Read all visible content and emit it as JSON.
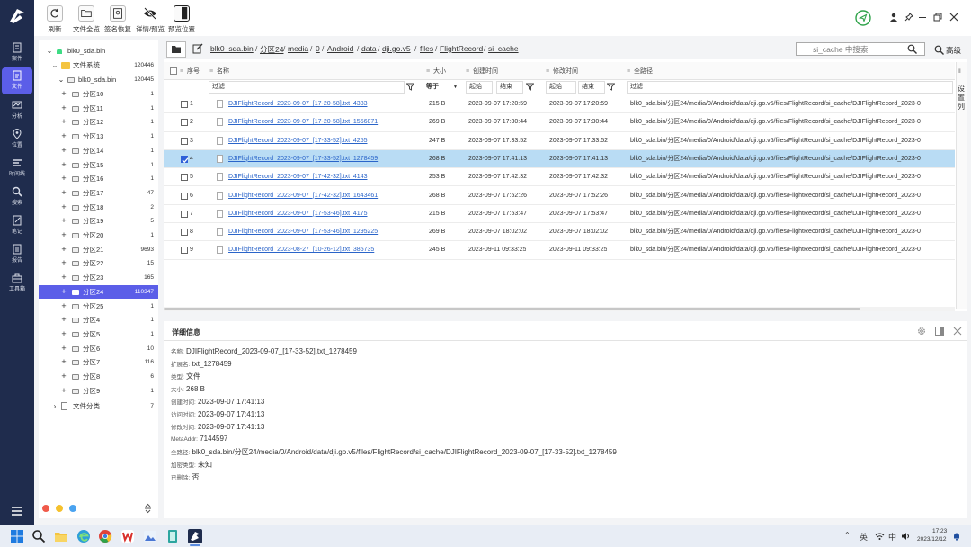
{
  "toolbar": {
    "refresh": "刷新",
    "file_overview": "文件全览",
    "signature_recovery": "签名恢复",
    "detail_preview": "详情/预览",
    "preview_position": "预览位置"
  },
  "rail": {
    "items": [
      "案件",
      "文件",
      "分析",
      "位置",
      "时间线",
      "搜索",
      "笔记",
      "报告",
      "工具箱"
    ]
  },
  "tree": {
    "root": "blk0_sda.bin",
    "fs": "文件系统",
    "fs_count": "120446",
    "disk": "blk0_sda.bin",
    "disk_count": "120445",
    "partitions": [
      {
        "name": "分区10",
        "count": "1"
      },
      {
        "name": "分区11",
        "count": "1"
      },
      {
        "name": "分区12",
        "count": "1"
      },
      {
        "name": "分区13",
        "count": "1"
      },
      {
        "name": "分区14",
        "count": "1"
      },
      {
        "name": "分区15",
        "count": "1"
      },
      {
        "name": "分区16",
        "count": "1"
      },
      {
        "name": "分区17",
        "count": "47"
      },
      {
        "name": "分区18",
        "count": "2"
      },
      {
        "name": "分区19",
        "count": "5"
      },
      {
        "name": "分区20",
        "count": "1"
      },
      {
        "name": "分区21",
        "count": "9693"
      },
      {
        "name": "分区22",
        "count": "15"
      },
      {
        "name": "分区23",
        "count": "165"
      },
      {
        "name": "分区24",
        "count": "110347"
      },
      {
        "name": "分区25",
        "count": "1"
      },
      {
        "name": "分区4",
        "count": "1"
      },
      {
        "name": "分区5",
        "count": "1"
      },
      {
        "name": "分区6",
        "count": "10"
      },
      {
        "name": "分区7",
        "count": "116"
      },
      {
        "name": "分区8",
        "count": "6"
      },
      {
        "name": "分区9",
        "count": "1"
      }
    ],
    "file_class": "文件分类",
    "file_class_count": "7"
  },
  "path": {
    "crumbs": [
      "blk0_sda.bin",
      "分区24",
      "media",
      "0",
      "Android",
      "data",
      "dji.go.v5",
      "files",
      "FlightRecord",
      "si_cache"
    ],
    "search_placeholder": "si_cache 中搜索",
    "advanced": "高级"
  },
  "table": {
    "headers": {
      "seq": "序号",
      "name": "名称",
      "size": "大小",
      "created": "创建时间",
      "modified": "修改时间",
      "fullpath": "全路径"
    },
    "filter": "过滤",
    "size_op": "等于",
    "start": "起始",
    "end": "结束",
    "settings_col": "设置列",
    "rows": [
      {
        "seq": "1",
        "name": "DJIFlightRecord_2023-09-07_[17-20-58].txt_4383",
        "size": "215 B",
        "created": "2023-09-07 17:20:59",
        "modified": "2023-09-07 17:20:59",
        "path": "blk0_sda.bin/分区24/media/0/Android/data/dji.go.v5/files/FlightRecord/si_cache/DJIFlightRecord_2023-0"
      },
      {
        "seq": "2",
        "name": "DJIFlightRecord_2023-09-07_[17-20-58].txt_1556871",
        "size": "269 B",
        "created": "2023-09-07 17:30:44",
        "modified": "2023-09-07 17:30:44",
        "path": "blk0_sda.bin/分区24/media/0/Android/data/dji.go.v5/files/FlightRecord/si_cache/DJIFlightRecord_2023-0"
      },
      {
        "seq": "3",
        "name": "DJIFlightRecord_2023-09-07_[17-33-52].txt_4255",
        "size": "247 B",
        "created": "2023-09-07 17:33:52",
        "modified": "2023-09-07 17:33:52",
        "path": "blk0_sda.bin/分区24/media/0/Android/data/dji.go.v5/files/FlightRecord/si_cache/DJIFlightRecord_2023-0"
      },
      {
        "seq": "4",
        "name": "DJIFlightRecord_2023-09-07_[17-33-52].txt_1278459",
        "size": "268 B",
        "created": "2023-09-07 17:41:13",
        "modified": "2023-09-07 17:41:13",
        "path": "blk0_sda.bin/分区24/media/0/Android/data/dji.go.v5/files/FlightRecord/si_cache/DJIFlightRecord_2023-0"
      },
      {
        "seq": "5",
        "name": "DJIFlightRecord_2023-09-07_[17-42-32].txt_4143",
        "size": "253 B",
        "created": "2023-09-07 17:42:32",
        "modified": "2023-09-07 17:42:32",
        "path": "blk0_sda.bin/分区24/media/0/Android/data/dji.go.v5/files/FlightRecord/si_cache/DJIFlightRecord_2023-0"
      },
      {
        "seq": "6",
        "name": "DJIFlightRecord_2023-09-07_[17-42-32].txt_1643461",
        "size": "268 B",
        "created": "2023-09-07 17:52:26",
        "modified": "2023-09-07 17:52:26",
        "path": "blk0_sda.bin/分区24/media/0/Android/data/dji.go.v5/files/FlightRecord/si_cache/DJIFlightRecord_2023-0"
      },
      {
        "seq": "7",
        "name": "DJIFlightRecord_2023-09-07_[17-53-46].txt_4175",
        "size": "215 B",
        "created": "2023-09-07 17:53:47",
        "modified": "2023-09-07 17:53:47",
        "path": "blk0_sda.bin/分区24/media/0/Android/data/dji.go.v5/files/FlightRecord/si_cache/DJIFlightRecord_2023-0"
      },
      {
        "seq": "8",
        "name": "DJIFlightRecord_2023-09-07_[17-53-46].txt_1295225",
        "size": "269 B",
        "created": "2023-09-07 18:02:02",
        "modified": "2023-09-07 18:02:02",
        "path": "blk0_sda.bin/分区24/media/0/Android/data/dji.go.v5/files/FlightRecord/si_cache/DJIFlightRecord_2023-0"
      },
      {
        "seq": "9",
        "name": "DJIFlightRecord_2023-08-27_[10-26-12].txt_385735",
        "size": "245 B",
        "created": "2023-09-11 09:33:25",
        "modified": "2023-09-11 09:33:25",
        "path": "blk0_sda.bin/分区24/media/0/Android/data/dji.go.v5/files/FlightRecord/si_cache/DJIFlightRecord_2023-0"
      }
    ]
  },
  "detail": {
    "title": "详细信息",
    "fields": [
      {
        "k": "名称:",
        "v": "DJIFlightRecord_2023-09-07_[17-33-52].txt_1278459"
      },
      {
        "k": "扩展名:",
        "v": "txt_1278459"
      },
      {
        "k": "类型:",
        "v": "文件"
      },
      {
        "k": "大小:",
        "v": "268 B"
      },
      {
        "k": "创建时间:",
        "v": "2023-09-07 17:41:13"
      },
      {
        "k": "访问时间:",
        "v": "2023-09-07 17:41:13"
      },
      {
        "k": "修改时间:",
        "v": "2023-09-07 17:41:13"
      },
      {
        "k": "MetaAddr:",
        "v": "7144597"
      },
      {
        "k": "全路径:",
        "v": "blk0_sda.bin/分区24/media/0/Android/data/dji.go.v5/files/FlightRecord/si_cache/DJIFlightRecord_2023-09-07_[17-33-52].txt_1278459"
      },
      {
        "k": "加密类型:",
        "v": "未知"
      },
      {
        "k": "已删除:",
        "v": "否"
      }
    ]
  },
  "taskbar": {
    "lang": "英",
    "ime": "中",
    "time": "17:23",
    "date": "2023/12/12"
  },
  "colors": {
    "accent": "#5b5ee8",
    "rail": "#1f2c4d",
    "link": "#2a64c9",
    "selected_row": "#b9dcf4"
  }
}
